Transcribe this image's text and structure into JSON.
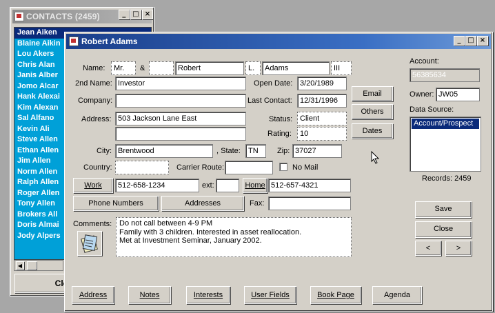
{
  "contacts_window": {
    "title": "CONTACTS (2459)",
    "items": [
      "Jean Aiken",
      "Blaine Aikin",
      "Lou Akers",
      "Chris Alan",
      "Janis Alber",
      "Jomo Alcar",
      "Hank Alexai",
      "Kim Alexan",
      "Sal Alfano",
      "Kevin Ali",
      "Steve Allen",
      "Ethan Allen",
      "Jim Allen",
      "Norm Allen",
      "Ralph Allen",
      "Roger Allen",
      "Tony Allen",
      "Brokers All",
      "Doris Almai",
      "Jody Alpers"
    ],
    "close_label": "Close"
  },
  "card_window": {
    "title": "Robert Adams",
    "name_label": "Name:",
    "amp_label": "&",
    "salutation": "Mr.",
    "spouse": "",
    "first_name": "Robert",
    "middle": "L.",
    "last_name": "Adams",
    "suffix": "III",
    "second_name_label": "2nd Name:",
    "second_name": "Investor",
    "company_label": "Company:",
    "company": "",
    "address_label": "Address:",
    "address1": "503 Jackson Lane East",
    "address2": "",
    "city_label": "City:",
    "city": "Brentwood",
    "state_label": ", State:",
    "state": "TN",
    "zip_label": "Zip:",
    "zip": "37027",
    "country_label": "Country:",
    "country": "",
    "carrier_label": "Carrier Route:",
    "carrier": "",
    "no_mail_label": "No Mail",
    "work_label": "Work",
    "work_phone": "512-658-1234",
    "ext_label": "ext:",
    "ext": "",
    "home_label": "Home",
    "home_phone": "512-657-4321",
    "phone_numbers_label": "Phone Numbers",
    "addresses_label": "Addresses",
    "fax_label": "Fax:",
    "fax": "",
    "open_date_label": "Open Date:",
    "open_date": "3/20/1989",
    "last_contact_label": "Last Contact:",
    "last_contact": "12/31/1996",
    "status_label": "Status:",
    "status": "Client",
    "rating_label": "Rating:",
    "rating": "10",
    "email_label": "Email",
    "others_label": "Others",
    "dates_label": "Dates",
    "account_label": "Account:",
    "account": "56385634",
    "owner_label": "Owner:",
    "owner": "JW05",
    "data_source_label": "Data Source:",
    "data_source": "Account/Prospect",
    "records_label": "Records: 2459",
    "save_label": "Save",
    "close_label": "Close",
    "prev_label": "<",
    "next_label": ">",
    "comments_label": "Comments:",
    "comments": [
      "Do not call between 4-9 PM",
      "Family with 3 children.  Interested in asset reallocation.",
      "Met at Investment Seminar, January 2002."
    ],
    "tabs": [
      "Address",
      "Notes",
      "Interests",
      "User Fields",
      "Book Page",
      "Agenda"
    ]
  }
}
